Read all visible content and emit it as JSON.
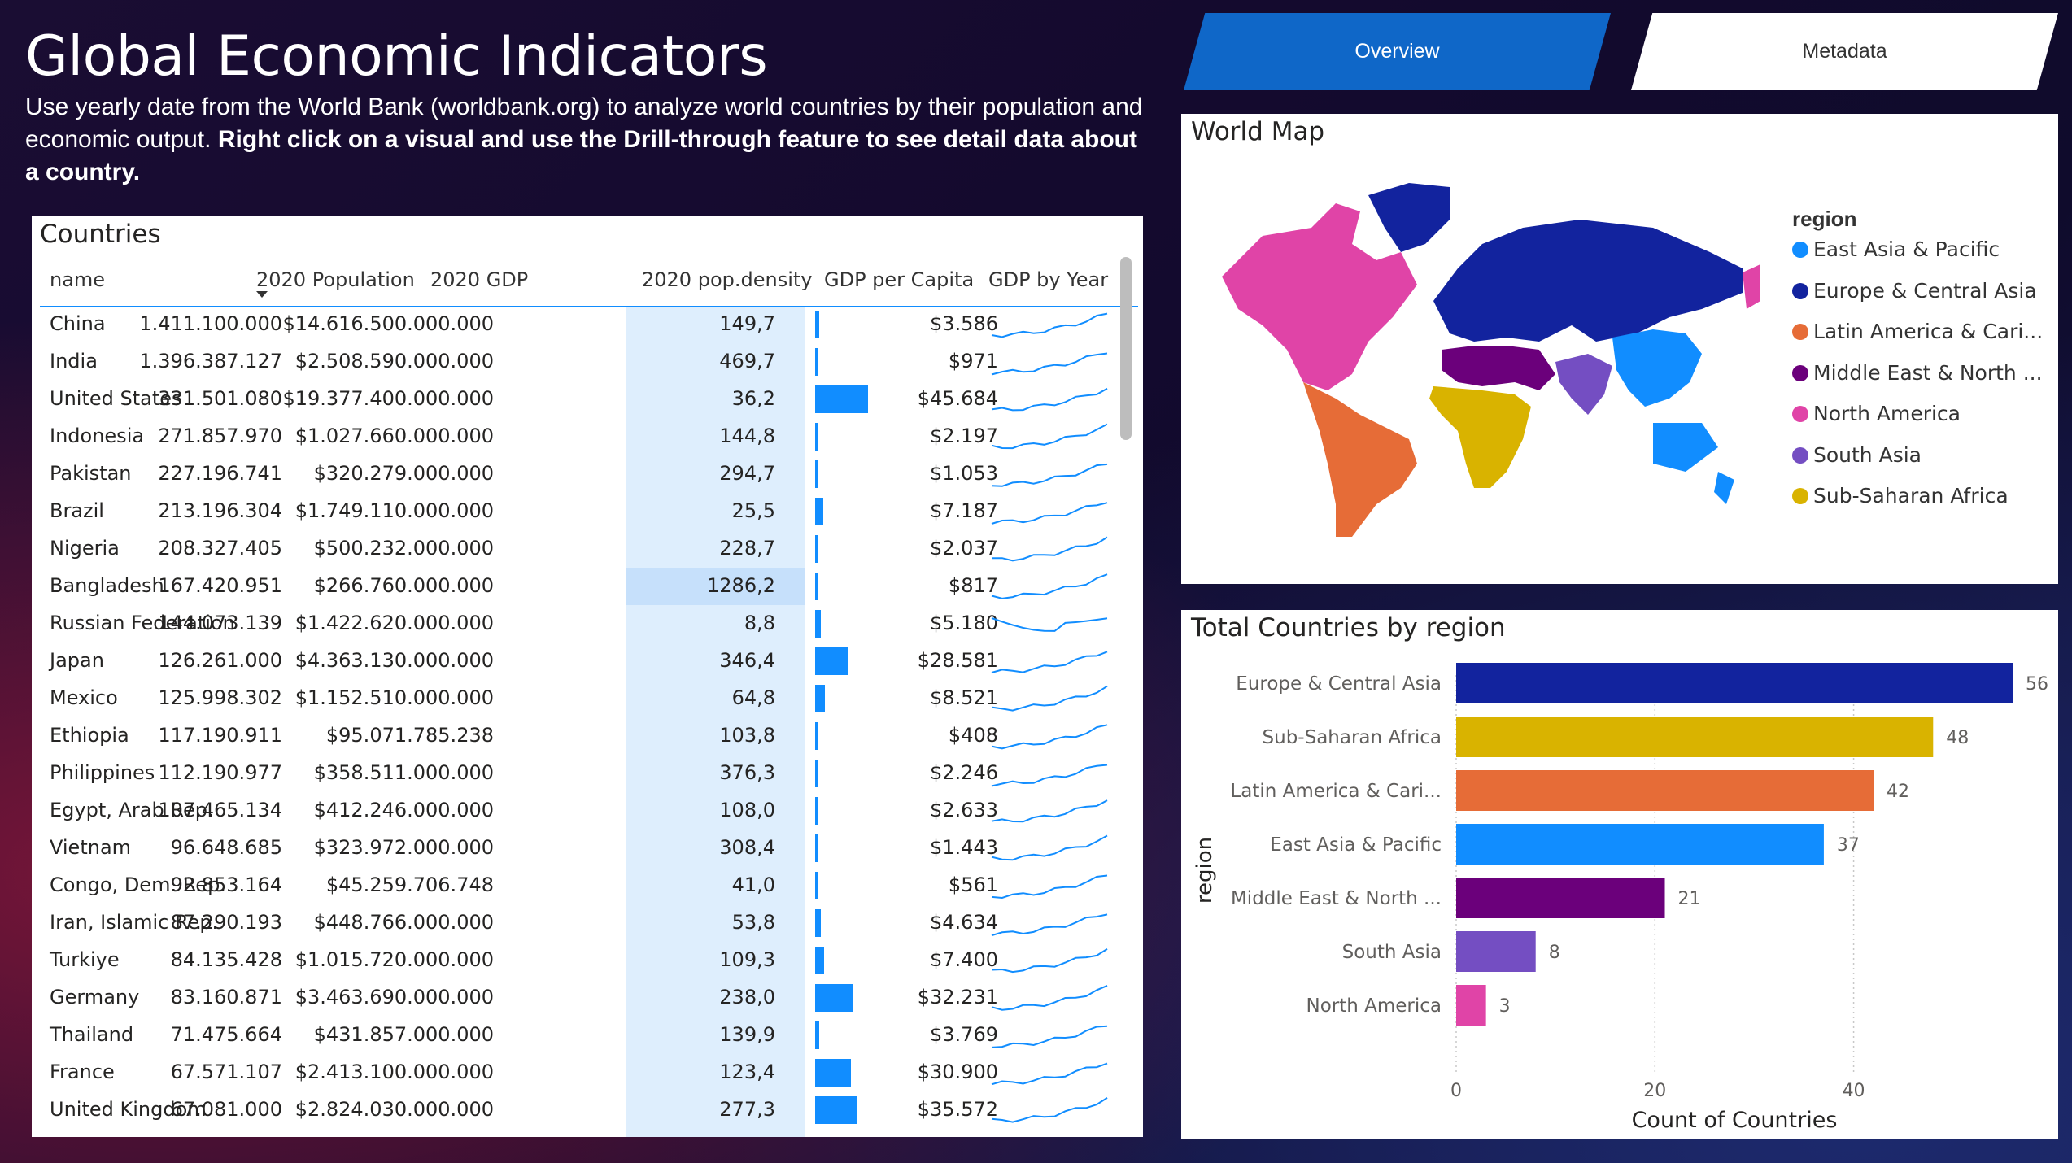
{
  "header": {
    "title": "Global Economic Indicators",
    "desc_plain": "Use yearly date from the World Bank (worldbank.org) to analyze world countries by their population and economic output. ",
    "desc_bold": "Right click on a visual and use the Drill-through feature to see detail data about a country."
  },
  "tabs": {
    "overview": "Overview",
    "metadata": "Metadata"
  },
  "table": {
    "title": "Countries",
    "columns": [
      "name",
      "2020 Population",
      "2020 GDP",
      "2020 pop.density",
      "GDP per Capita",
      "GDP by Year"
    ],
    "rows": [
      {
        "name": "China",
        "pop": "1.411.100.000",
        "gdp": "$14.616.500.000.000",
        "density": "149,7",
        "gpc": "$3.586",
        "gpc_value": 3586
      },
      {
        "name": "India",
        "pop": "1.396.387.127",
        "gdp": "$2.508.590.000.000",
        "density": "469,7",
        "gpc": "$971",
        "gpc_value": 971
      },
      {
        "name": "United States",
        "pop": "331.501.080",
        "gdp": "$19.377.400.000.000",
        "density": "36,2",
        "gpc": "$45.684",
        "gpc_value": 45684
      },
      {
        "name": "Indonesia",
        "pop": "271.857.970",
        "gdp": "$1.027.660.000.000",
        "density": "144,8",
        "gpc": "$2.197",
        "gpc_value": 2197
      },
      {
        "name": "Pakistan",
        "pop": "227.196.741",
        "gdp": "$320.279.000.000",
        "density": "294,7",
        "gpc": "$1.053",
        "gpc_value": 1053
      },
      {
        "name": "Brazil",
        "pop": "213.196.304",
        "gdp": "$1.749.110.000.000",
        "density": "25,5",
        "gpc": "$7.187",
        "gpc_value": 7187
      },
      {
        "name": "Nigeria",
        "pop": "208.327.405",
        "gdp": "$500.232.000.000",
        "density": "228,7",
        "gpc": "$2.037",
        "gpc_value": 2037
      },
      {
        "name": "Bangladesh",
        "pop": "167.420.951",
        "gdp": "$266.760.000.000",
        "density": "1286,2",
        "gpc": "$817",
        "gpc_value": 817
      },
      {
        "name": "Russian Federation",
        "pop": "144.073.139",
        "gdp": "$1.422.620.000.000",
        "density": "8,8",
        "gpc": "$5.180",
        "gpc_value": 5180
      },
      {
        "name": "Japan",
        "pop": "126.261.000",
        "gdp": "$4.363.130.000.000",
        "density": "346,4",
        "gpc": "$28.581",
        "gpc_value": 28581
      },
      {
        "name": "Mexico",
        "pop": "125.998.302",
        "gdp": "$1.152.510.000.000",
        "density": "64,8",
        "gpc": "$8.521",
        "gpc_value": 8521
      },
      {
        "name": "Ethiopia",
        "pop": "117.190.911",
        "gdp": "$95.071.785.238",
        "density": "103,8",
        "gpc": "$408",
        "gpc_value": 408
      },
      {
        "name": "Philippines",
        "pop": "112.190.977",
        "gdp": "$358.511.000.000",
        "density": "376,3",
        "gpc": "$2.246",
        "gpc_value": 2246
      },
      {
        "name": "Egypt, Arab Rep.",
        "pop": "107.465.134",
        "gdp": "$412.246.000.000",
        "density": "108,0",
        "gpc": "$2.633",
        "gpc_value": 2633
      },
      {
        "name": "Vietnam",
        "pop": "96.648.685",
        "gdp": "$323.972.000.000",
        "density": "308,4",
        "gpc": "$1.443",
        "gpc_value": 1443
      },
      {
        "name": "Congo, Dem. Rep.",
        "pop": "92.853.164",
        "gdp": "$45.259.706.748",
        "density": "41,0",
        "gpc": "$561",
        "gpc_value": 561
      },
      {
        "name": "Iran, Islamic Rep.",
        "pop": "87.290.193",
        "gdp": "$448.766.000.000",
        "density": "53,8",
        "gpc": "$4.634",
        "gpc_value": 4634
      },
      {
        "name": "Turkiye",
        "pop": "84.135.428",
        "gdp": "$1.015.720.000.000",
        "density": "109,3",
        "gpc": "$7.400",
        "gpc_value": 7400
      },
      {
        "name": "Germany",
        "pop": "83.160.871",
        "gdp": "$3.463.690.000.000",
        "density": "238,0",
        "gpc": "$32.231",
        "gpc_value": 32231
      },
      {
        "name": "Thailand",
        "pop": "71.475.664",
        "gdp": "$431.857.000.000",
        "density": "139,9",
        "gpc": "$3.769",
        "gpc_value": 3769
      },
      {
        "name": "France",
        "pop": "67.571.107",
        "gdp": "$2.413.100.000.000",
        "density": "123,4",
        "gpc": "$30.900",
        "gpc_value": 30900
      },
      {
        "name": "United Kingdom",
        "pop": "67.081.000",
        "gdp": "$2.824.030.000.000",
        "density": "277,3",
        "gpc": "$35.572",
        "gpc_value": 35572
      }
    ]
  },
  "map": {
    "title": "World Map",
    "legend_title": "region",
    "legend": [
      {
        "label": "East Asia & Pacific",
        "color": "#118dff"
      },
      {
        "label": "Europe & Central Asia",
        "color": "#12239e"
      },
      {
        "label": "Latin America & Cari...",
        "color": "#e66c37"
      },
      {
        "label": "Middle East & North ...",
        "color": "#6b007b"
      },
      {
        "label": "North America",
        "color": "#e044a7"
      },
      {
        "label": "South Asia",
        "color": "#744ec2"
      },
      {
        "label": "Sub-Saharan Africa",
        "color": "#d9b300"
      }
    ]
  },
  "chart_data": {
    "type": "bar",
    "orientation": "horizontal",
    "title": "Total Countries by region",
    "xlabel": "Count of Countries",
    "ylabel": "region",
    "categories": [
      "Europe & Central Asia",
      "Sub-Saharan Africa",
      "Latin America & Cari...",
      "East Asia & Pacific",
      "Middle East & North ...",
      "South Asia",
      "North America"
    ],
    "values": [
      56,
      48,
      42,
      37,
      21,
      8,
      3
    ],
    "colors": [
      "#12239e",
      "#d9b300",
      "#e66c37",
      "#118dff",
      "#6b007b",
      "#744ec2",
      "#e044a7"
    ],
    "xticks": [
      "0",
      "20",
      "40"
    ],
    "xlim": [
      0,
      56
    ],
    "grid": true
  }
}
